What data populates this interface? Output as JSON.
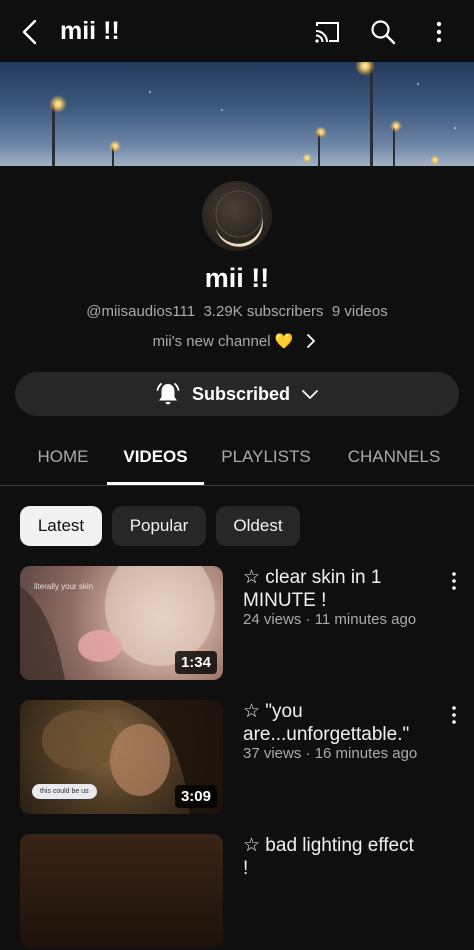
{
  "header": {
    "title": "mii !!"
  },
  "channel": {
    "name": "mii !!",
    "handle": "@miisaudios111",
    "subscribers": "3.29K subscribers",
    "videos_count": "9 videos",
    "description": "mii's new channel 💛"
  },
  "subscribe": {
    "label": "Subscribed"
  },
  "tabs": [
    {
      "label": "HOME"
    },
    {
      "label": "VIDEOS"
    },
    {
      "label": "PLAYLISTS"
    },
    {
      "label": "CHANNELS"
    }
  ],
  "filters": [
    {
      "label": "Latest"
    },
    {
      "label": "Popular"
    },
    {
      "label": "Oldest"
    }
  ],
  "videos": [
    {
      "title_line1": "☆ clear skin in 1",
      "title_line2": "MINUTE !",
      "meta": "24 views · 11 minutes ago",
      "duration": "1:34",
      "thumb_text": "literally your skin"
    },
    {
      "title_line1": "☆ \"you",
      "title_line2": "are...unforgettable.\"",
      "meta": "37 views · 16 minutes ago",
      "duration": "3:09",
      "thumb_text": "this could be us"
    },
    {
      "title_line1": "☆ bad lighting effect",
      "title_line2": "!"
    }
  ],
  "icons": {
    "back": "back-arrow-icon",
    "cast": "cast-icon",
    "search": "search-icon",
    "more": "more-vert-icon",
    "bell": "bell-icon",
    "chevron_down": "chevron-down-icon",
    "chevron_right": "chevron-right-icon"
  },
  "colors": {
    "background": "#0f0f0f",
    "chip": "#272727",
    "chip_selected": "#f1f1f1",
    "secondary_text": "#aaaaaa"
  }
}
